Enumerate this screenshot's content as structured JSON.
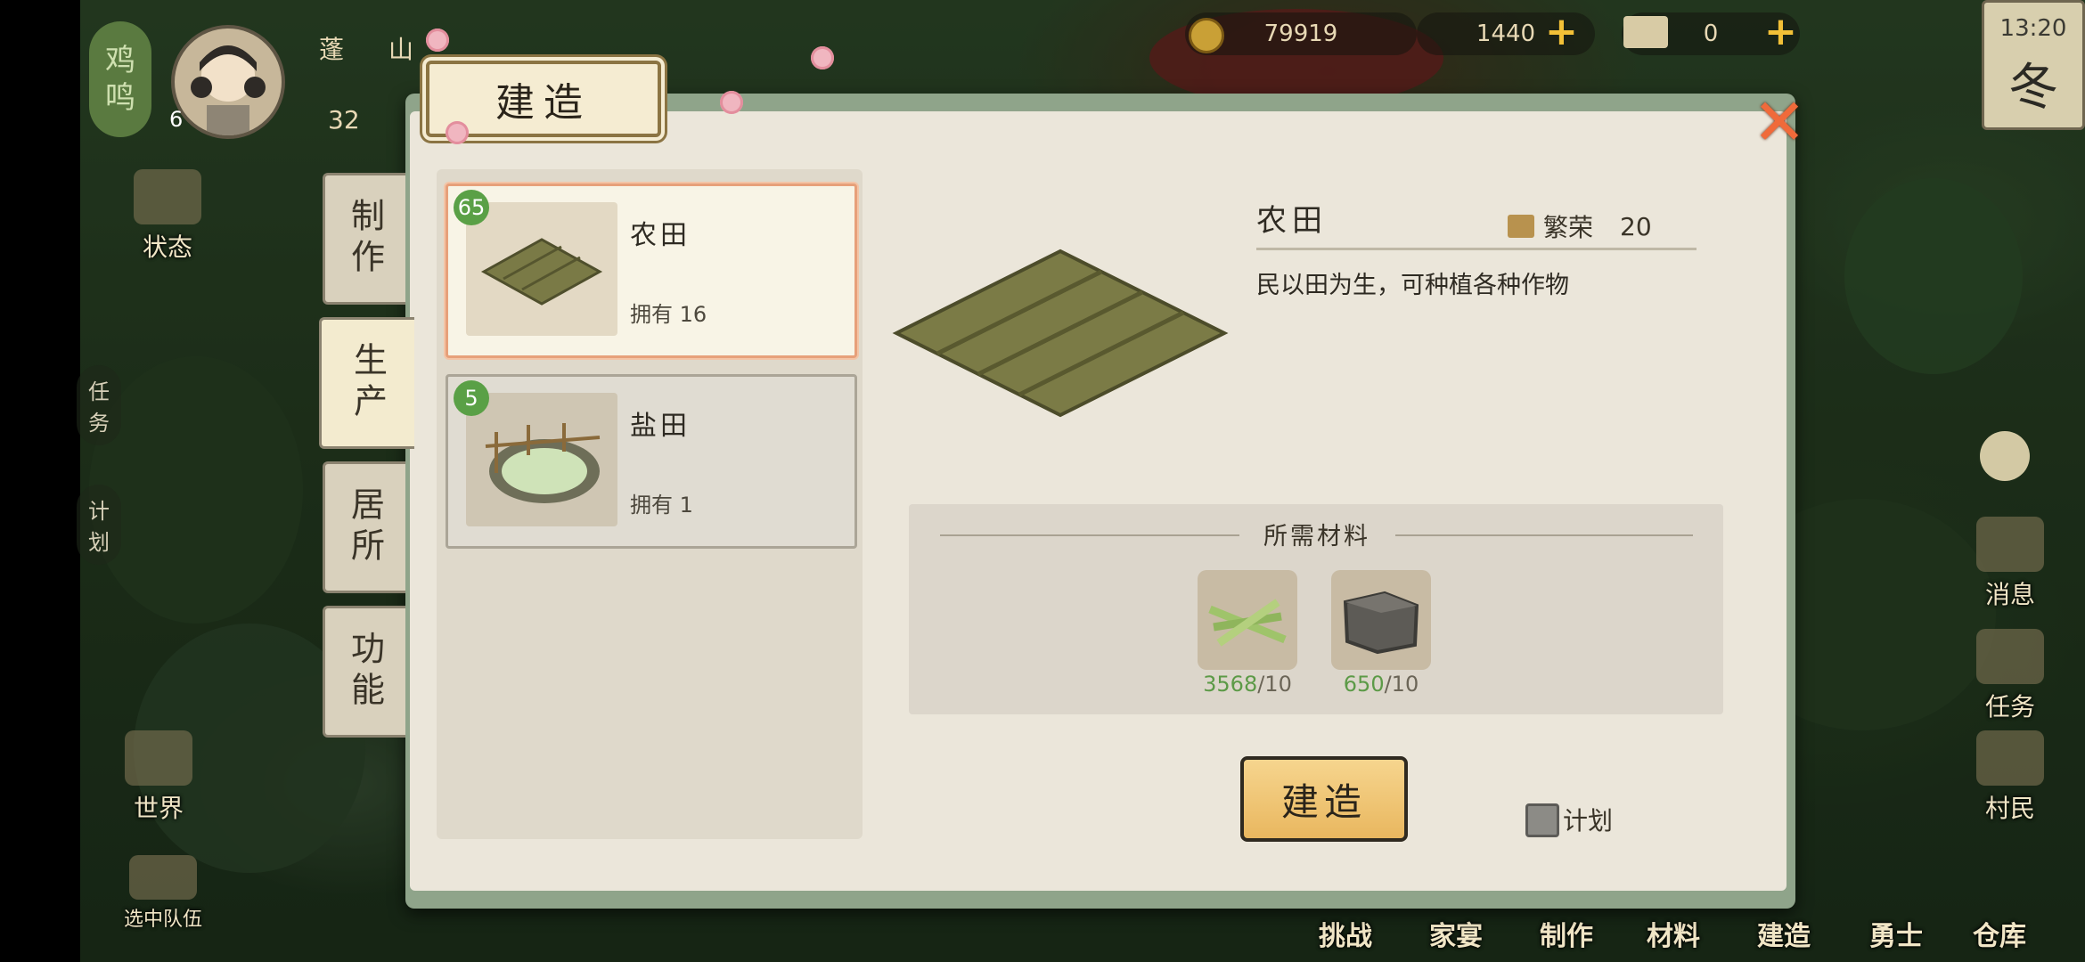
{
  "hud": {
    "coins": "79919",
    "jade": "1440",
    "tickets": "0",
    "time": "13:20",
    "season": "冬"
  },
  "player": {
    "badge_line1": "鸡",
    "badge_line2": "鸣",
    "level": "6",
    "name_partial": "蓬",
    "village_partial": "山",
    "stat_partial": "32"
  },
  "left_menu": {
    "status": "状态",
    "world": "世界",
    "team": "选中队伍",
    "task_small": [
      "任",
      "务"
    ],
    "plan_small": [
      "计",
      "划"
    ]
  },
  "right_menu": {
    "message": "消息",
    "task": "任务",
    "villager": "村民"
  },
  "bottom_bar": [
    "挑战",
    "家宴",
    "制作",
    "材料",
    "建造",
    "勇士",
    "仓库"
  ],
  "modal": {
    "title": "建造",
    "tabs": [
      "制作",
      "生产",
      "居所",
      "功能"
    ],
    "active_tab": "生产",
    "buildings": [
      {
        "level": "65",
        "name": "农田",
        "owned": "拥有 16",
        "selected": true
      },
      {
        "level": "5",
        "name": "盐田",
        "owned": "拥有 1",
        "selected": false
      }
    ],
    "detail": {
      "name": "农田",
      "prosperity_label": "繁荣",
      "prosperity_value": "20",
      "description": "民以田为生，可种植各种作物"
    },
    "materials_title": "所需材料",
    "materials": [
      {
        "name": "bamboo",
        "have": "3568",
        "need": "/10"
      },
      {
        "name": "stone",
        "have": "650",
        "need": "/10"
      }
    ],
    "build_button": "建造",
    "plan_label": "计划"
  }
}
